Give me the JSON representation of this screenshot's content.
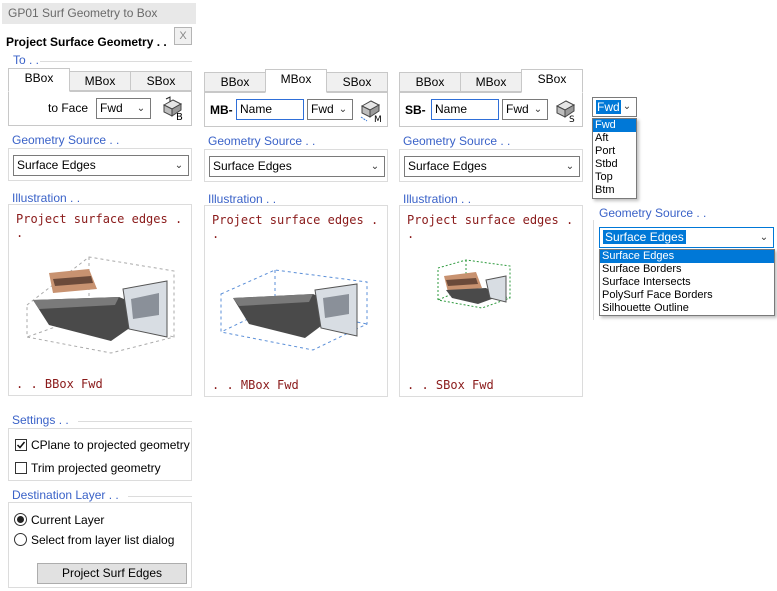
{
  "window": {
    "title": "GP01 Surf Geometry to Box",
    "close_glyph": "X"
  },
  "header": {
    "title": "Project Surface Geometry . ."
  },
  "to": {
    "label": "To . ."
  },
  "col1": {
    "tabs": [
      "BBox",
      "MBox",
      "SBox"
    ],
    "to_face_label": "to Face",
    "face_value": "Fwd",
    "geometry_source_label": "Geometry Source . .",
    "geometry_source_value": "Surface Edges",
    "illustration_label": "Illustration . .",
    "illus_top": "Project surface edges . .",
    "illus_bottom": ". . BBox Fwd",
    "icon_letter": "B"
  },
  "col2": {
    "tabs": [
      "BBox",
      "MBox",
      "SBox"
    ],
    "prefix": "MB-",
    "name_value": "Name",
    "face_value": "Fwd",
    "geometry_source_label": "Geometry Source . .",
    "geometry_source_value": "Surface Edges",
    "illustration_label": "Illustration . .",
    "illus_top": "Project surface edges . .",
    "illus_bottom": ". . MBox Fwd",
    "icon_letter": "M"
  },
  "col3": {
    "tabs": [
      "BBox",
      "MBox",
      "SBox"
    ],
    "prefix": "SB-",
    "name_value": "Name",
    "face_value": "Fwd",
    "geometry_source_label": "Geometry Source . .",
    "geometry_source_value": "Surface Edges",
    "illustration_label": "Illustration . .",
    "illus_top": "Project surface edges . .",
    "illus_bottom": ". . SBox Fwd",
    "icon_letter": "S"
  },
  "face_dropdown": {
    "value": "Fwd",
    "options": [
      "Fwd",
      "Aft",
      "Port",
      "Stbd",
      "Top",
      "Btm"
    ]
  },
  "geo_dropdown": {
    "label": "Geometry Source . .",
    "value": "Surface Edges",
    "options": [
      "Surface Edges",
      "Surface Borders",
      "Surface Intersects",
      "PolySurf Face Borders",
      "Silhouette Outline"
    ]
  },
  "settings": {
    "label": "Settings . .",
    "cplane_label": "CPlane to projected geometry",
    "cplane_checked": true,
    "trim_label": "Trim projected geometry",
    "trim_checked": false
  },
  "destination": {
    "label": "Destination Layer . .",
    "current_label": "Current Layer",
    "select_label": "Select from layer list dialog"
  },
  "action": {
    "button_label": "Project Surf Edges"
  },
  "colors": {
    "section_label": "#3a62c8",
    "illus_text": "#8a1a1a",
    "selection": "#0078d7"
  }
}
